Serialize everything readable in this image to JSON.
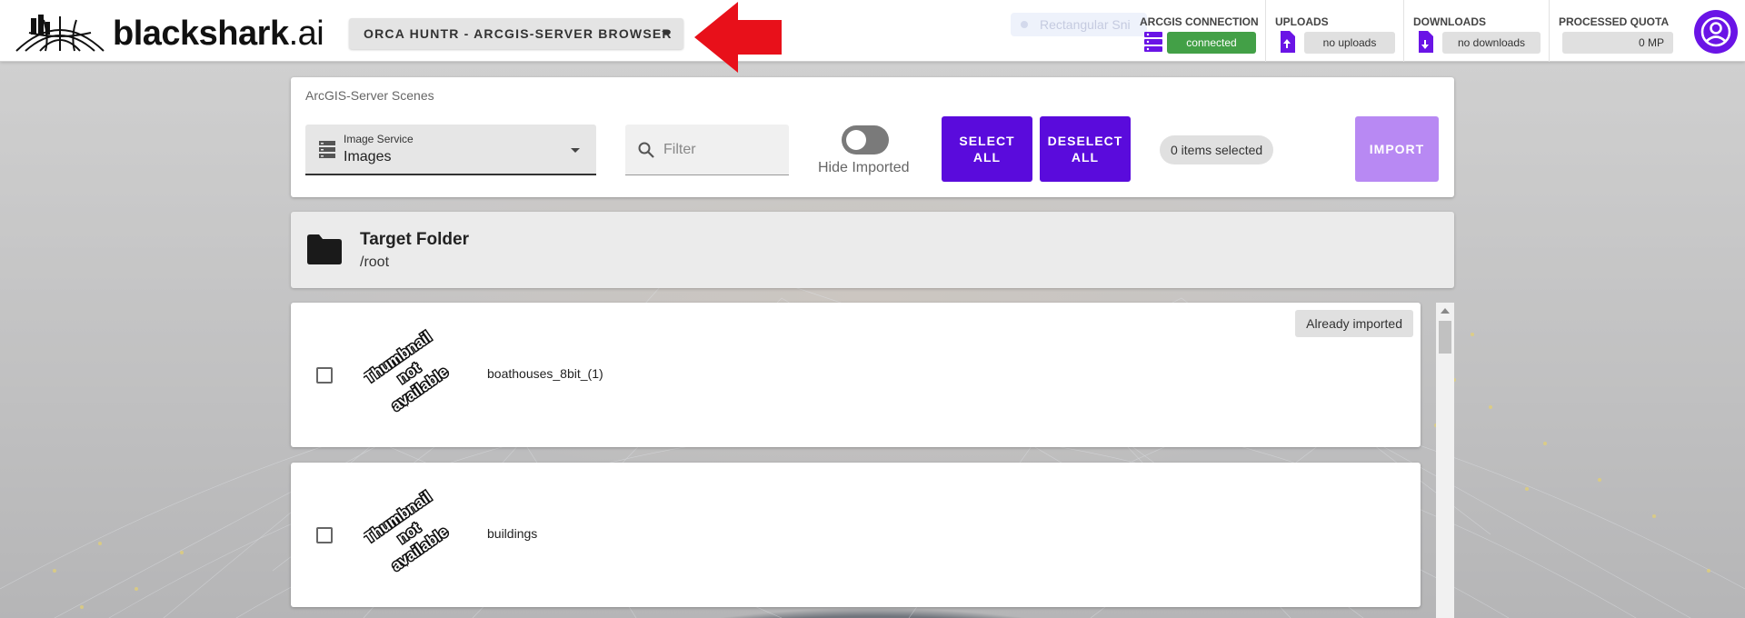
{
  "app": {
    "brand": "blackshark",
    "brand_suffix": ".ai",
    "selector_label": "ORCA HUNTR - ARCGIS-SERVER BROWSER",
    "ghost_chip": "Rectangular Sni"
  },
  "status": {
    "arcgis": {
      "label": "ARCGIS CONNECTION",
      "value": "connected",
      "color": "#43a047"
    },
    "uploads": {
      "label": "UPLOADS",
      "value": "no uploads"
    },
    "downloads": {
      "label": "DOWNLOADS",
      "value": "no downloads"
    },
    "quota": {
      "label": "PROCESSED QUOTA",
      "value": "0 MP"
    }
  },
  "controls": {
    "heading": "ArcGIS-Server Scenes",
    "service_label": "Image Service",
    "service_value": "Images",
    "filter_placeholder": "Filter",
    "hide_imported_label": "Hide Imported",
    "select_all": "SELECT ALL",
    "deselect_all": "DESELECT ALL",
    "selected_count": "0 items selected",
    "import": "IMPORT"
  },
  "target_folder": {
    "title": "Target Folder",
    "path": "/root"
  },
  "items": [
    {
      "name": "boathouses_8bit_(1)",
      "thumbnail_text": "Thumbnail not available",
      "badge": "Already imported"
    },
    {
      "name": "buildings",
      "thumbnail_text": "Thumbnail not available"
    }
  ],
  "colors": {
    "primary": "#5a0bdc",
    "import_disabled": "#b889f3",
    "connected": "#43a047",
    "arrow": "#e8101a"
  }
}
